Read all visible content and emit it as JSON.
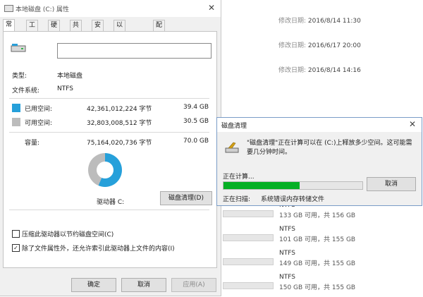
{
  "explorer": {
    "modified_label": "修改日期:",
    "files": [
      {
        "modified": "2016/8/14 11:30"
      },
      {
        "modified": "2016/6/17 20:00"
      },
      {
        "modified": "2016/8/14 14:16"
      }
    ],
    "drives": [
      {
        "fs": "NTFS",
        "free_text": "133 GB 可用，共 156 GB"
      },
      {
        "fs": "NTFS",
        "free_text": "101 GB 可用，共 155 GB"
      },
      {
        "fs": "NTFS",
        "free_text": "149 GB 可用，共 155 GB"
      },
      {
        "fs": "NTFS",
        "free_text": "150 GB 可用，共 155 GB"
      }
    ]
  },
  "props": {
    "title": "本地磁盘 (C:) 属性",
    "tabs": [
      "常规",
      "工具",
      "硬件",
      "共享",
      "安全",
      "以前的版本",
      "配额"
    ],
    "name_value": "",
    "type_label": "类型:",
    "type_value": "本地磁盘",
    "fs_label": "文件系统:",
    "fs_value": "NTFS",
    "used_label": "已用空间:",
    "used_bytes": "42,361,012,224 字节",
    "used_gb": "39.4 GB",
    "free_label": "可用空间:",
    "free_bytes": "32,803,008,512 字节",
    "free_gb": "30.5 GB",
    "cap_label": "容量:",
    "cap_bytes": "75,164,020,736 字节",
    "cap_gb": "70.0 GB",
    "drive_label": "驱动器 C:",
    "cleanup_button": "磁盘清理(D)",
    "compress_label": "压缩此驱动器以节约磁盘空间(C)",
    "compress_checked": false,
    "index_label": "除了文件属性外，还允许索引此驱动器上文件的内容(I)",
    "index_checked": true,
    "ok": "确定",
    "cancel": "取消",
    "apply": "应用(A)",
    "colors": {
      "used": "#26a0da",
      "free": "#bcbcbc"
    },
    "used_fraction": 0.564
  },
  "cleanup": {
    "title": "磁盘清理",
    "message": "\"磁盘清理\"正在计算可以在 (C:)上释放多少空间。这可能需要几分钟时间。",
    "computing": "正在计算...",
    "cancel": "取消",
    "scanning_label": "正在扫描:",
    "scanning_item": "系统错误内存转储文件",
    "progress": 0.55
  }
}
